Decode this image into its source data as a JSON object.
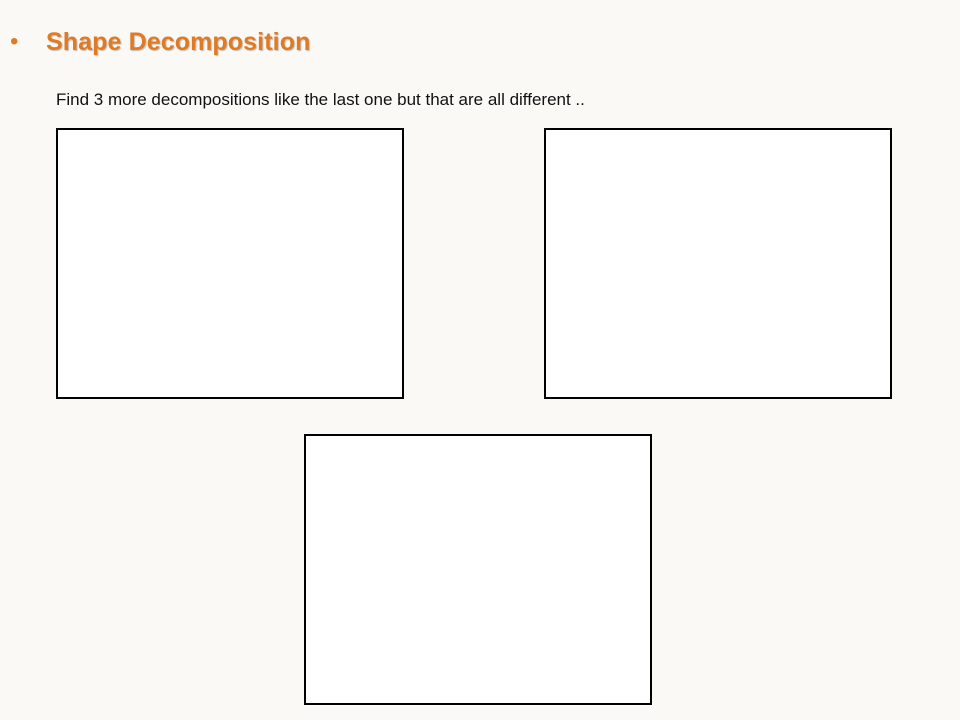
{
  "slide": {
    "bullet": "•",
    "title": "Shape Decomposition",
    "instruction": "Find 3 more decompositions like the last one but that are all different .."
  },
  "colors": {
    "accent": "#e07b24",
    "background": "#fbf9f6",
    "box_fill": "#ffffff",
    "box_border": "#000000"
  }
}
